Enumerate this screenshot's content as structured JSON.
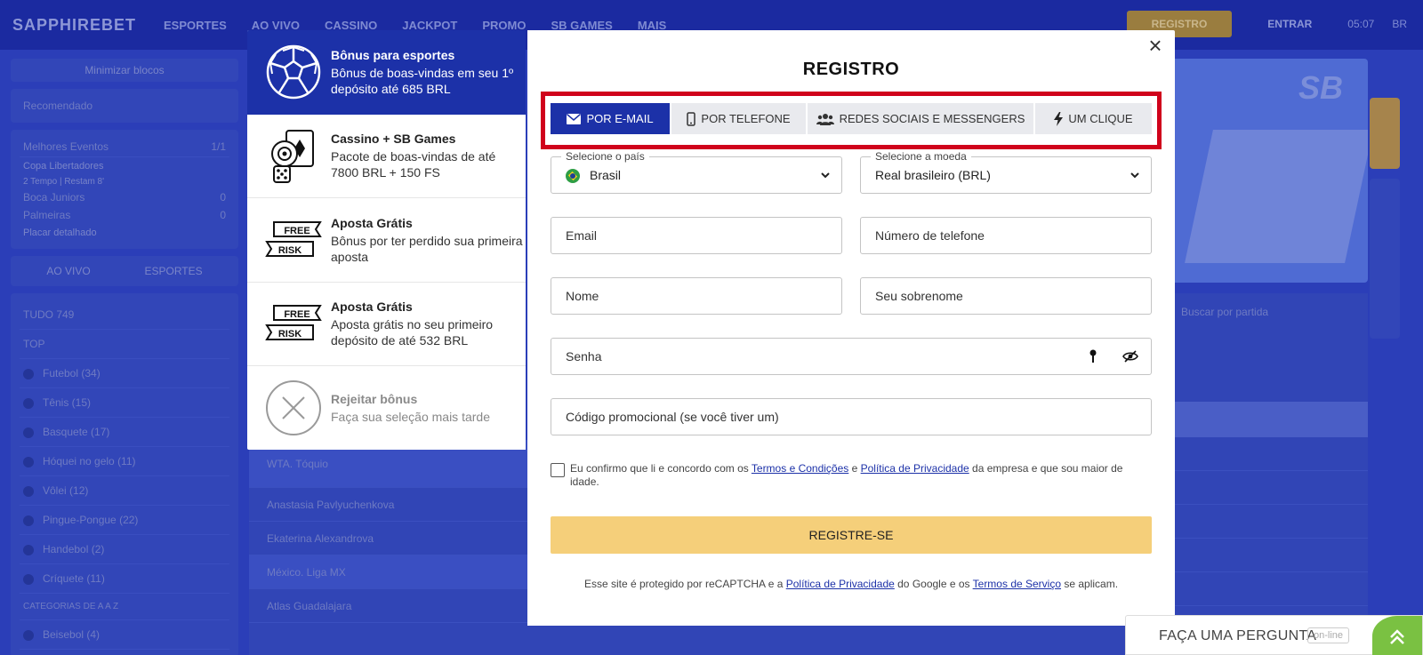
{
  "background": {
    "logo": "SAPPHIREBET",
    "nav": [
      "ESPORTES",
      "AO VIVO",
      "CASSINO",
      "JACKPOT",
      "PROMO",
      "SB GAMES",
      "MAIS"
    ],
    "register_label": "REGISTRO",
    "enter_label": "ENTRAR",
    "time": "05:07",
    "lang": "BR",
    "sidebar": {
      "hide_label": "Minimizar blocos",
      "recommended": "Recomendado",
      "best_events": "Melhores Eventos",
      "best_events_count": "1/1",
      "match_league": "Copa Libertadores",
      "match_time": "2 Tempo | Restam 8'",
      "team_a": "Boca Juniors",
      "team_b": "Palmeiras",
      "score_a": "0",
      "score_b": "0",
      "detailed": "Placar detalhado",
      "tab_live": "AO VIVO",
      "tab_sports": "ESPORTES",
      "all_label": "TUDO 749",
      "top_label": "TOP",
      "sports": [
        "Futebol (34)",
        "Tênis (15)",
        "Basquete (17)",
        "Hóquei no gelo (11)",
        "Vôlei (12)",
        "Pingue-Pongue (22)",
        "Handebol (2)",
        "Críquete (11)"
      ],
      "categories_label": "CATEGORIAS DE A A Z",
      "last_sport": "Beisebol (4)"
    },
    "center": {
      "row1": "WTA. Tóquio",
      "row2": "Anastasia Pavlyuchenkova",
      "row3": "Ekaterina Alexandrova",
      "row4": "México. Liga MX",
      "row5": "Atlas Guadalajara"
    },
    "search_placeholder": "Buscar por partida"
  },
  "bonus_panel": {
    "items": [
      {
        "title": "Bônus para esportes",
        "desc": "Bônus de boas-vindas em seu 1º depósito até 685 BRL",
        "icon": "soccer-ball-icon"
      },
      {
        "title": "Cassino + SB Games",
        "desc": "Pacote de boas-vindas de até 7800 BRL + 150 FS",
        "icon": "casino-chips-icon"
      },
      {
        "title": "Aposta Grátis",
        "desc": "Bônus por ter perdido sua primeira aposta",
        "icon": "free-risk-icon",
        "badge_top": "FREE",
        "badge_bottom": "RISK"
      },
      {
        "title": "Aposta Grátis",
        "desc": "Aposta grátis no seu primeiro depósito de até 532 BRL",
        "icon": "free-risk-icon",
        "badge_top": "FREE",
        "badge_bottom": "RISK"
      },
      {
        "title": "Rejeitar bônus",
        "desc": "Faça sua seleção mais tarde",
        "icon": "reject-x-icon"
      }
    ]
  },
  "modal": {
    "title": "REGISTRO",
    "close": "×",
    "tabs": [
      {
        "label": "POR E-MAIL",
        "icon": "envelope-icon"
      },
      {
        "label": "POR TELEFONE",
        "icon": "phone-icon"
      },
      {
        "label": "REDES SOCIAIS E MESSENGERS",
        "icon": "users-icon"
      },
      {
        "label": "UM CLIQUE",
        "icon": "lightning-icon"
      }
    ],
    "country": {
      "legend": "Selecione o país",
      "value": "Brasil"
    },
    "currency": {
      "legend": "Selecione a moeda",
      "value": "Real brasileiro (BRL)"
    },
    "email_placeholder": "Email",
    "phone_placeholder": "Número de telefone",
    "name_placeholder": "Nome",
    "surname_placeholder": "Seu sobrenome",
    "password_placeholder": "Senha",
    "promo_placeholder": "Código promocional (se você tiver um)",
    "consent": {
      "pre": "Eu confirmo que li e concordo com os ",
      "terms": "Termos e Condições",
      "mid": " e ",
      "privacy": "Política de Privacidade",
      "post": " da empresa e que sou maior de idade."
    },
    "submit_label": "REGISTRE-SE",
    "recaptcha": {
      "pre": "Esse site é protegido por reCAPTCHA e a ",
      "privacy": "Política de Privacidade",
      "mid": " do Google e os ",
      "terms": "Termos de Serviço",
      "post": " se aplicam."
    }
  },
  "help": {
    "label": "FAÇA UMA PERGUNTA",
    "status": "on-line"
  },
  "colors": {
    "brand_blue": "#1c31a8",
    "submit": "#f5cf7a",
    "highlight": "#d0021b",
    "help_green": "#7ac142"
  }
}
